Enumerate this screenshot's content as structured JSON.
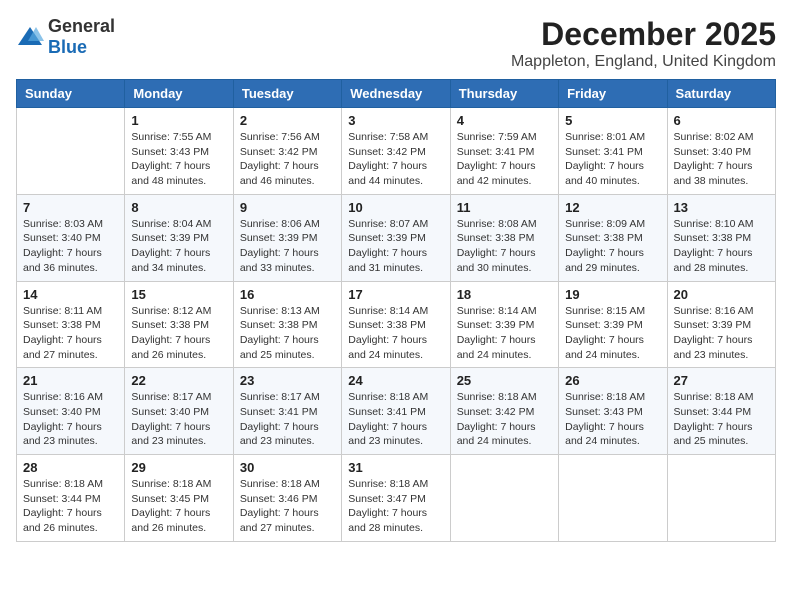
{
  "logo": {
    "general": "General",
    "blue": "Blue"
  },
  "title": "December 2025",
  "subtitle": "Mappleton, England, United Kingdom",
  "days_of_week": [
    "Sunday",
    "Monday",
    "Tuesday",
    "Wednesday",
    "Thursday",
    "Friday",
    "Saturday"
  ],
  "weeks": [
    [
      {
        "day": "",
        "info": ""
      },
      {
        "day": "1",
        "info": "Sunrise: 7:55 AM\nSunset: 3:43 PM\nDaylight: 7 hours\nand 48 minutes."
      },
      {
        "day": "2",
        "info": "Sunrise: 7:56 AM\nSunset: 3:42 PM\nDaylight: 7 hours\nand 46 minutes."
      },
      {
        "day": "3",
        "info": "Sunrise: 7:58 AM\nSunset: 3:42 PM\nDaylight: 7 hours\nand 44 minutes."
      },
      {
        "day": "4",
        "info": "Sunrise: 7:59 AM\nSunset: 3:41 PM\nDaylight: 7 hours\nand 42 minutes."
      },
      {
        "day": "5",
        "info": "Sunrise: 8:01 AM\nSunset: 3:41 PM\nDaylight: 7 hours\nand 40 minutes."
      },
      {
        "day": "6",
        "info": "Sunrise: 8:02 AM\nSunset: 3:40 PM\nDaylight: 7 hours\nand 38 minutes."
      }
    ],
    [
      {
        "day": "7",
        "info": "Sunrise: 8:03 AM\nSunset: 3:40 PM\nDaylight: 7 hours\nand 36 minutes."
      },
      {
        "day": "8",
        "info": "Sunrise: 8:04 AM\nSunset: 3:39 PM\nDaylight: 7 hours\nand 34 minutes."
      },
      {
        "day": "9",
        "info": "Sunrise: 8:06 AM\nSunset: 3:39 PM\nDaylight: 7 hours\nand 33 minutes."
      },
      {
        "day": "10",
        "info": "Sunrise: 8:07 AM\nSunset: 3:39 PM\nDaylight: 7 hours\nand 31 minutes."
      },
      {
        "day": "11",
        "info": "Sunrise: 8:08 AM\nSunset: 3:38 PM\nDaylight: 7 hours\nand 30 minutes."
      },
      {
        "day": "12",
        "info": "Sunrise: 8:09 AM\nSunset: 3:38 PM\nDaylight: 7 hours\nand 29 minutes."
      },
      {
        "day": "13",
        "info": "Sunrise: 8:10 AM\nSunset: 3:38 PM\nDaylight: 7 hours\nand 28 minutes."
      }
    ],
    [
      {
        "day": "14",
        "info": "Sunrise: 8:11 AM\nSunset: 3:38 PM\nDaylight: 7 hours\nand 27 minutes."
      },
      {
        "day": "15",
        "info": "Sunrise: 8:12 AM\nSunset: 3:38 PM\nDaylight: 7 hours\nand 26 minutes."
      },
      {
        "day": "16",
        "info": "Sunrise: 8:13 AM\nSunset: 3:38 PM\nDaylight: 7 hours\nand 25 minutes."
      },
      {
        "day": "17",
        "info": "Sunrise: 8:14 AM\nSunset: 3:38 PM\nDaylight: 7 hours\nand 24 minutes."
      },
      {
        "day": "18",
        "info": "Sunrise: 8:14 AM\nSunset: 3:39 PM\nDaylight: 7 hours\nand 24 minutes."
      },
      {
        "day": "19",
        "info": "Sunrise: 8:15 AM\nSunset: 3:39 PM\nDaylight: 7 hours\nand 24 minutes."
      },
      {
        "day": "20",
        "info": "Sunrise: 8:16 AM\nSunset: 3:39 PM\nDaylight: 7 hours\nand 23 minutes."
      }
    ],
    [
      {
        "day": "21",
        "info": "Sunrise: 8:16 AM\nSunset: 3:40 PM\nDaylight: 7 hours\nand 23 minutes."
      },
      {
        "day": "22",
        "info": "Sunrise: 8:17 AM\nSunset: 3:40 PM\nDaylight: 7 hours\nand 23 minutes."
      },
      {
        "day": "23",
        "info": "Sunrise: 8:17 AM\nSunset: 3:41 PM\nDaylight: 7 hours\nand 23 minutes."
      },
      {
        "day": "24",
        "info": "Sunrise: 8:18 AM\nSunset: 3:41 PM\nDaylight: 7 hours\nand 23 minutes."
      },
      {
        "day": "25",
        "info": "Sunrise: 8:18 AM\nSunset: 3:42 PM\nDaylight: 7 hours\nand 24 minutes."
      },
      {
        "day": "26",
        "info": "Sunrise: 8:18 AM\nSunset: 3:43 PM\nDaylight: 7 hours\nand 24 minutes."
      },
      {
        "day": "27",
        "info": "Sunrise: 8:18 AM\nSunset: 3:44 PM\nDaylight: 7 hours\nand 25 minutes."
      }
    ],
    [
      {
        "day": "28",
        "info": "Sunrise: 8:18 AM\nSunset: 3:44 PM\nDaylight: 7 hours\nand 26 minutes."
      },
      {
        "day": "29",
        "info": "Sunrise: 8:18 AM\nSunset: 3:45 PM\nDaylight: 7 hours\nand 26 minutes."
      },
      {
        "day": "30",
        "info": "Sunrise: 8:18 AM\nSunset: 3:46 PM\nDaylight: 7 hours\nand 27 minutes."
      },
      {
        "day": "31",
        "info": "Sunrise: 8:18 AM\nSunset: 3:47 PM\nDaylight: 7 hours\nand 28 minutes."
      },
      {
        "day": "",
        "info": ""
      },
      {
        "day": "",
        "info": ""
      },
      {
        "day": "",
        "info": ""
      }
    ]
  ]
}
